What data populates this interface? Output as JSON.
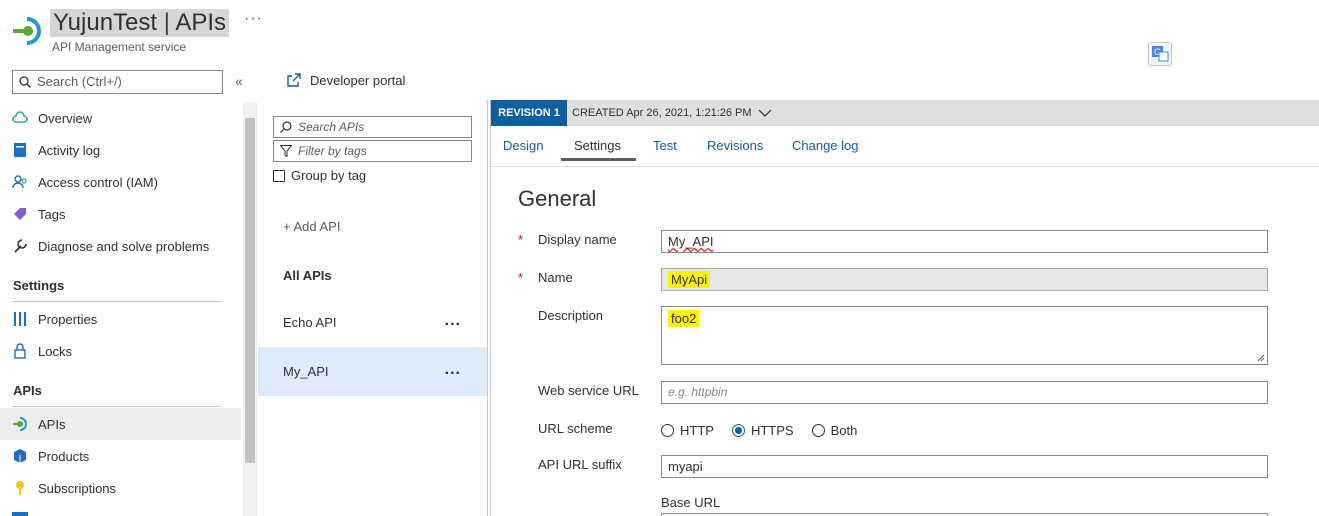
{
  "header": {
    "service_name": "YujunTest",
    "separator": "|",
    "page": "APIs",
    "subtitle": "API Management service",
    "more": "···"
  },
  "nav": {
    "search_placeholder": "Search (Ctrl+/)",
    "collapse": "«",
    "items": [
      {
        "label": "Overview",
        "icon": "cloud-icon"
      },
      {
        "label": "Activity log",
        "icon": "activity-log-icon"
      },
      {
        "label": "Access control (IAM)",
        "icon": "people-icon"
      },
      {
        "label": "Tags",
        "icon": "tag-icon"
      },
      {
        "label": "Diagnose and solve problems",
        "icon": "wrench-icon"
      }
    ],
    "settings_header": "Settings",
    "settings_items": [
      {
        "label": "Properties",
        "icon": "sliders-icon"
      },
      {
        "label": "Locks",
        "icon": "lock-icon"
      }
    ],
    "apis_header": "APIs",
    "apis_items": [
      {
        "label": "APIs",
        "icon": "api-icon",
        "active": true
      },
      {
        "label": "Products",
        "icon": "products-icon"
      },
      {
        "label": "Subscriptions",
        "icon": "key-icon"
      }
    ]
  },
  "toolbar": {
    "developer_portal": "Developer portal"
  },
  "api_list": {
    "search_placeholder": "Search APIs",
    "filter_placeholder": "Filter by tags",
    "group_by_tag": "Group by tag",
    "add_api": "+ Add API",
    "all_apis": "All APIs",
    "apis": [
      {
        "name": "Echo API",
        "menu": "..."
      },
      {
        "name": "My_API",
        "menu": "..."
      }
    ]
  },
  "revision": {
    "badge": "REVISION 1",
    "created": "CREATED Apr 26, 2021, 1:21:26 PM"
  },
  "tabs": [
    "Design",
    "Settings",
    "Test",
    "Revisions",
    "Change log"
  ],
  "form": {
    "section_title": "General",
    "required_mark": "*",
    "display_name_label": "Display name",
    "display_name_value": "My_API",
    "name_label": "Name",
    "name_value": "MyApi",
    "description_label": "Description",
    "description_value": "foo2",
    "web_service_url_label": "Web service URL",
    "web_service_url_placeholder": "e.g. httpbin",
    "url_scheme_label": "URL scheme",
    "url_scheme_options": [
      "HTTP",
      "HTTPS",
      "Both"
    ],
    "url_scheme_selected": "HTTPS",
    "api_url_suffix_label": "API URL suffix",
    "api_url_suffix_value": "myapi",
    "base_url_label": "Base URL"
  },
  "colors": {
    "accent": "#0f5fa0",
    "highlight": "#fff200",
    "selected_row": "#deecf9"
  }
}
